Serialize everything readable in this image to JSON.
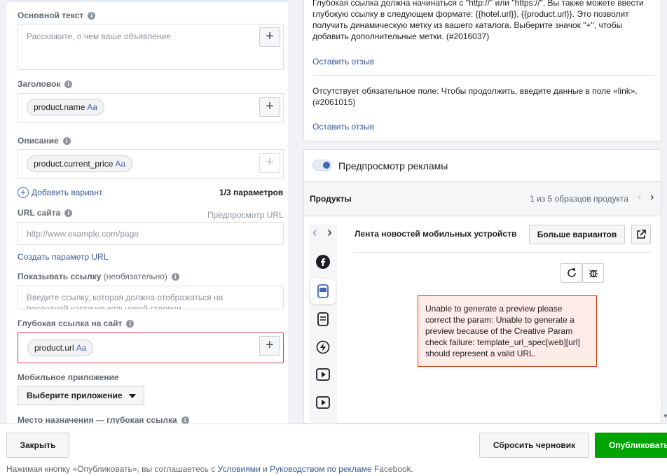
{
  "form": {
    "primary_text": {
      "label": "Основной текст",
      "placeholder": "Расскажите, о чем ваше объявление"
    },
    "headline": {
      "label": "Заголовок",
      "token": "product.name",
      "token_suffix": "Aa"
    },
    "description": {
      "label": "Описание",
      "token": "product.current_price",
      "token_suffix": "Aa"
    },
    "add_variant": "Добавить вариант",
    "params_count": "1",
    "params_suffix": "/3 параметров",
    "website_url": {
      "label": "URL сайта",
      "preview_link": "Предпросмотр URL",
      "placeholder": "http://www.example.com/page"
    },
    "create_url_param": "Создать параметр URL",
    "display_link": {
      "label": "Показывать ссылку",
      "optional": "(необязательно)",
      "placeholder_line1": "Введите ссылку, которая должна отображаться на",
      "placeholder_line2": "последней карточке кольцевой галереи"
    },
    "deep_link": {
      "label": "Глубокая ссылка на сайт",
      "token": "product.url",
      "token_suffix": "Aa"
    },
    "mobile_app": {
      "label": "Мобильное приложение",
      "select": "Выберите приложение"
    },
    "destination": {
      "label": "Место назначения — глубокая ссылка"
    }
  },
  "messages": {
    "msg1_line0": "Глубокая ссылка должна начинаться с \"http://\" или \"https://\". Вы также можете ввести",
    "msg1_line1": "глубокую ссылку в следующем формате: {{hotel.url}}, {{product.url}}. Это позволит",
    "msg1_line2": "получить динамическую метку из вашего каталога. Выберите значок \"+\", чтобы",
    "msg1_line3": "добавить дополнительные метки. (#2016037)",
    "feedback1": "Оставить отзыв",
    "msg2_line1": "Отсутствует обязательное поле: Чтобы продолжить, введите данные в поле «link».",
    "msg2_line2": "(#2061015)",
    "feedback2": "Оставить отзыв"
  },
  "preview": {
    "title": "Предпросмотр рекламы",
    "products_label": "Продукты",
    "sample_count": "1 из 5 образцов продукта",
    "placement": "Лента новостей мобильных устройств",
    "more_variants": "Больше вариантов",
    "error_text": "Unable to generate a preview please correct the param: Unable to generate a preview because of the Creative Param check failure: template_url_spec[web][url] should represent a valid URL."
  },
  "footer": {
    "close": "Закрыть",
    "reset_draft": "Сбросить черновик",
    "publish": "Опубликовать",
    "terms_prefix": "Нажимая кнопку «Опубликовать», вы соглашаетесь с ",
    "terms_link1": "Условиями",
    "terms_and": " и ",
    "terms_link2": "Руководством по рекламе",
    "terms_suffix": " Facebook."
  },
  "colors": {
    "accent": "#4267b2",
    "publish": "#00a400",
    "error_border": "#dd3c10",
    "error_bg": "#ffebe8",
    "link": "#385898"
  }
}
